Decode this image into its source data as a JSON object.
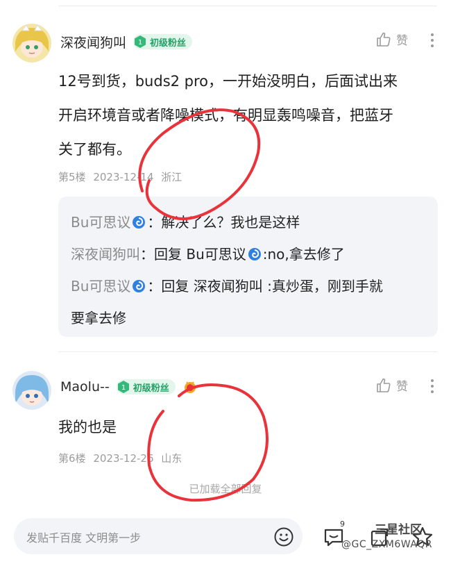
{
  "posts": [
    {
      "username": "深夜闻狗叫",
      "badge_level": "1",
      "badge_text": "初级粉丝",
      "like_label": "赞",
      "content_lines": [
        "12号到货，buds2 pro，一开始没明白，后面试出来",
        "开启环境音或者降噪模式，有明显轰鸣噪音，把蓝牙",
        "关了都有。"
      ],
      "floor": "第5楼",
      "date": "2023-12-14",
      "region": "浙江",
      "replies": [
        {
          "name": "Bu可思议",
          "text": "：解决了么？我也是这样"
        },
        {
          "name": "深夜闻狗叫",
          "text": "：回复 Bu可思议",
          "text2": ":no,拿去修了"
        },
        {
          "name": "Bu可思议",
          "text": "：回复 深夜闻狗叫 :真炒蛋，刚到手就",
          "text_cont": "要拿去修"
        }
      ]
    },
    {
      "username": "Maolu--",
      "badge_level": "1",
      "badge_text": "初级粉丝",
      "like_label": "赞",
      "content_lines": [
        "我的也是"
      ],
      "floor": "第6楼",
      "date": "2023-12-26",
      "region": "山东"
    }
  ],
  "loaded_all": "已加载全部回复",
  "bottom": {
    "placeholder": "发贴千百度 文明第一步",
    "comment_count": "9"
  },
  "watermark": {
    "line1": "三星社区",
    "line2": "@GC_ZXM6WAQR"
  },
  "colors": {
    "badge_green": "#25a267",
    "badge_bg": "#e3f6ec",
    "reply_bg": "#f3f4f7",
    "annotation_red": "#e8333a"
  },
  "icons": [
    "thumb-up-icon",
    "more-vertical-icon",
    "swirl-emoji-icon",
    "smile-icon",
    "comment-icon",
    "share-icon",
    "star-icon"
  ]
}
